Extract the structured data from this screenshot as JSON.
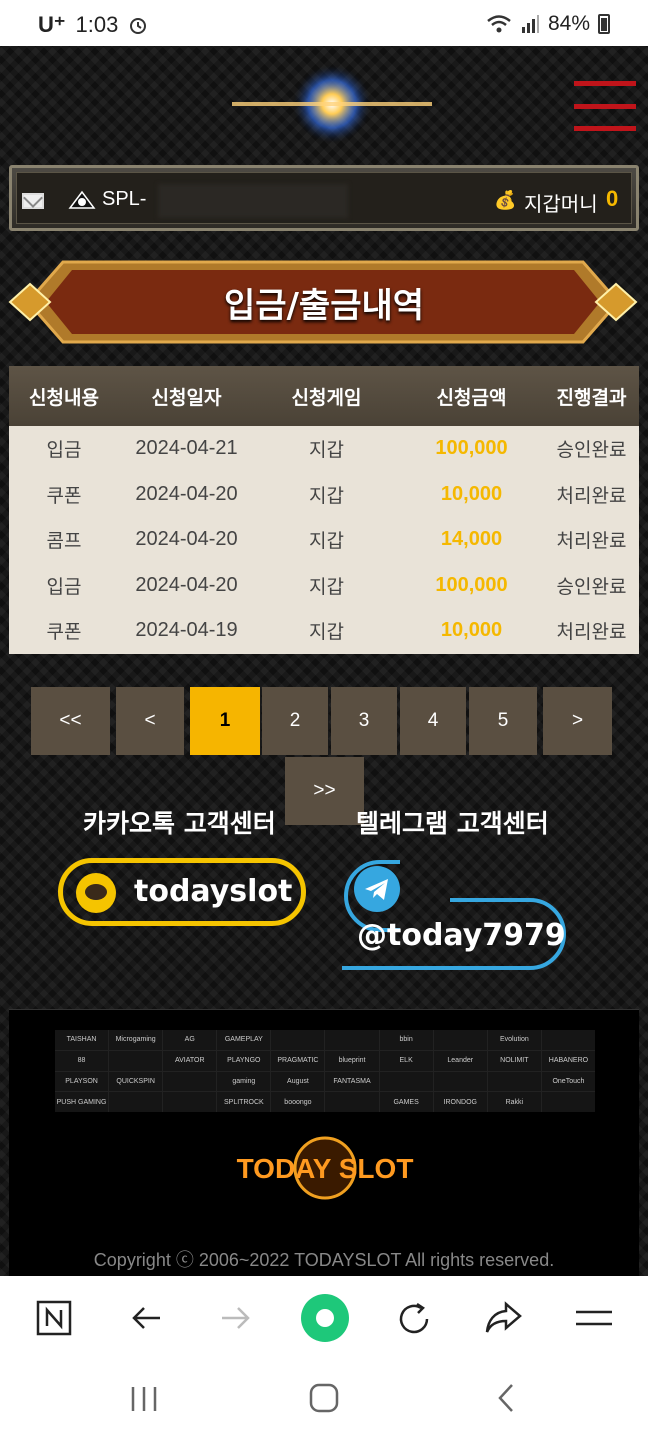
{
  "status_bar": {
    "carrier": "U⁺",
    "time": "1:03",
    "battery": "84%"
  },
  "user_bar": {
    "user_id": "SPL-",
    "money_label": "지갑머니",
    "money_value": "0"
  },
  "page_title": "입금/출금내역",
  "table": {
    "headers": [
      "신청내용",
      "신청일자",
      "신청게임",
      "신청금액",
      "진행결과"
    ],
    "rows": [
      [
        "입금",
        "2024-04-21",
        "지갑",
        "100,000",
        "승인완료"
      ],
      [
        "쿠폰",
        "2024-04-20",
        "지갑",
        "10,000",
        "처리완료"
      ],
      [
        "콤프",
        "2024-04-20",
        "지갑",
        "14,000",
        "처리완료"
      ],
      [
        "입금",
        "2024-04-20",
        "지갑",
        "100,000",
        "승인완료"
      ],
      [
        "쿠폰",
        "2024-04-19",
        "지갑",
        "10,000",
        "처리완료"
      ]
    ]
  },
  "pagination": {
    "first": "<<",
    "prev": "<",
    "pages": [
      "1",
      "2",
      "3",
      "4",
      "5"
    ],
    "current": "1",
    "next": ">",
    "last": ">>"
  },
  "support": {
    "kakao_label": "카카오톡 고객센터",
    "kakao_id": "todayslot",
    "telegram_label": "텔레그램 고객센터",
    "telegram_id": "@today7979"
  },
  "footer": {
    "providers": [
      "TAISHAN",
      "Microgaming",
      "AG",
      "GAMEPLAY",
      "",
      "",
      "bbin",
      "",
      "Evolution",
      "",
      "88",
      "",
      "AVIATOR",
      "PLAYNGO",
      "PRAGMATIC",
      "blueprint",
      "ELK",
      "Leander",
      "NOLIMIT",
      "HABANERO",
      "PLAYSON",
      "QUICKSPIN",
      "",
      "gaming",
      "August",
      "FANTASMA",
      "",
      "",
      "",
      "OneTouch",
      "PUSH GAMING",
      "",
      "",
      "SPLITROCK",
      "booongo",
      "",
      "GAMES",
      "IRONDOG",
      "Rakki",
      ""
    ],
    "brand_text": "TODAY SLOT",
    "copyright": "Copyright ⓒ 2006~2022 TODAYSLOT All rights reserved."
  },
  "colors": {
    "accent": "#f6b500",
    "menu": "#c0141a",
    "kakao": "#f5c400",
    "telegram": "#36a7e0"
  }
}
